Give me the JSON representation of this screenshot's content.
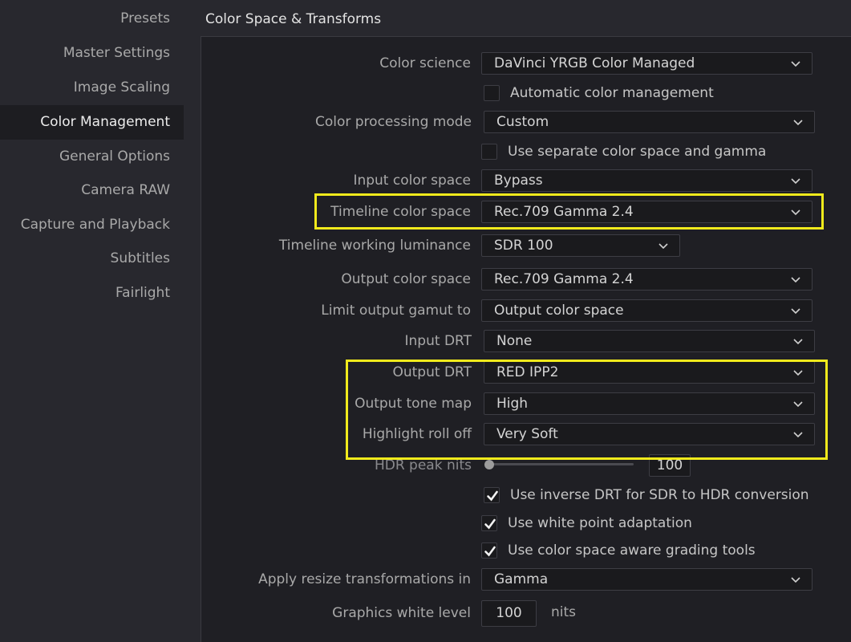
{
  "sidebar": {
    "items": [
      {
        "label": "Presets"
      },
      {
        "label": "Master Settings"
      },
      {
        "label": "Image Scaling"
      },
      {
        "label": "Color Management",
        "active": true
      },
      {
        "label": "General Options"
      },
      {
        "label": "Camera RAW"
      },
      {
        "label": "Capture and Playback"
      },
      {
        "label": "Subtitles"
      },
      {
        "label": "Fairlight"
      }
    ]
  },
  "section": {
    "title": "Color Space & Transforms"
  },
  "fields": {
    "color_science": {
      "label": "Color science",
      "value": "DaVinci YRGB Color Managed"
    },
    "auto_color_mgmt": {
      "label": "Automatic color management",
      "checked": false
    },
    "color_processing_mode": {
      "label": "Color processing mode",
      "value": "Custom"
    },
    "separate_gamma": {
      "label": "Use separate color space and gamma",
      "checked": false
    },
    "input_color_space": {
      "label": "Input color space",
      "value": "Bypass"
    },
    "timeline_color_space": {
      "label": "Timeline color space",
      "value": "Rec.709 Gamma 2.4"
    },
    "timeline_working_luminance": {
      "label": "Timeline working luminance",
      "value": "SDR 100"
    },
    "output_color_space": {
      "label": "Output color space",
      "value": "Rec.709 Gamma 2.4"
    },
    "limit_output_gamut": {
      "label": "Limit output gamut to",
      "value": "Output color space"
    },
    "input_drt": {
      "label": "Input DRT",
      "value": "None"
    },
    "output_drt": {
      "label": "Output DRT",
      "value": "RED IPP2"
    },
    "output_tone_map": {
      "label": "Output tone map",
      "value": "High"
    },
    "highlight_roll_off": {
      "label": "Highlight roll off",
      "value": "Very Soft"
    },
    "hdr_peak_nits": {
      "label": "HDR peak nits",
      "value": "100",
      "slider_fraction": 0.0
    },
    "inverse_drt": {
      "label": "Use inverse DRT for SDR to HDR conversion",
      "checked": true
    },
    "white_point_adaptation": {
      "label": "Use white point adaptation",
      "checked": true
    },
    "aware_grading_tools": {
      "label": "Use color space aware grading tools",
      "checked": true
    },
    "resize_transformations": {
      "label": "Apply resize transformations in",
      "value": "Gamma"
    },
    "graphics_white_level": {
      "label": "Graphics white level",
      "value": "100",
      "unit": "nits"
    }
  },
  "colors": {
    "highlight": "#f0ea1c",
    "background": "#28282e",
    "panel": "#1f1f24"
  }
}
